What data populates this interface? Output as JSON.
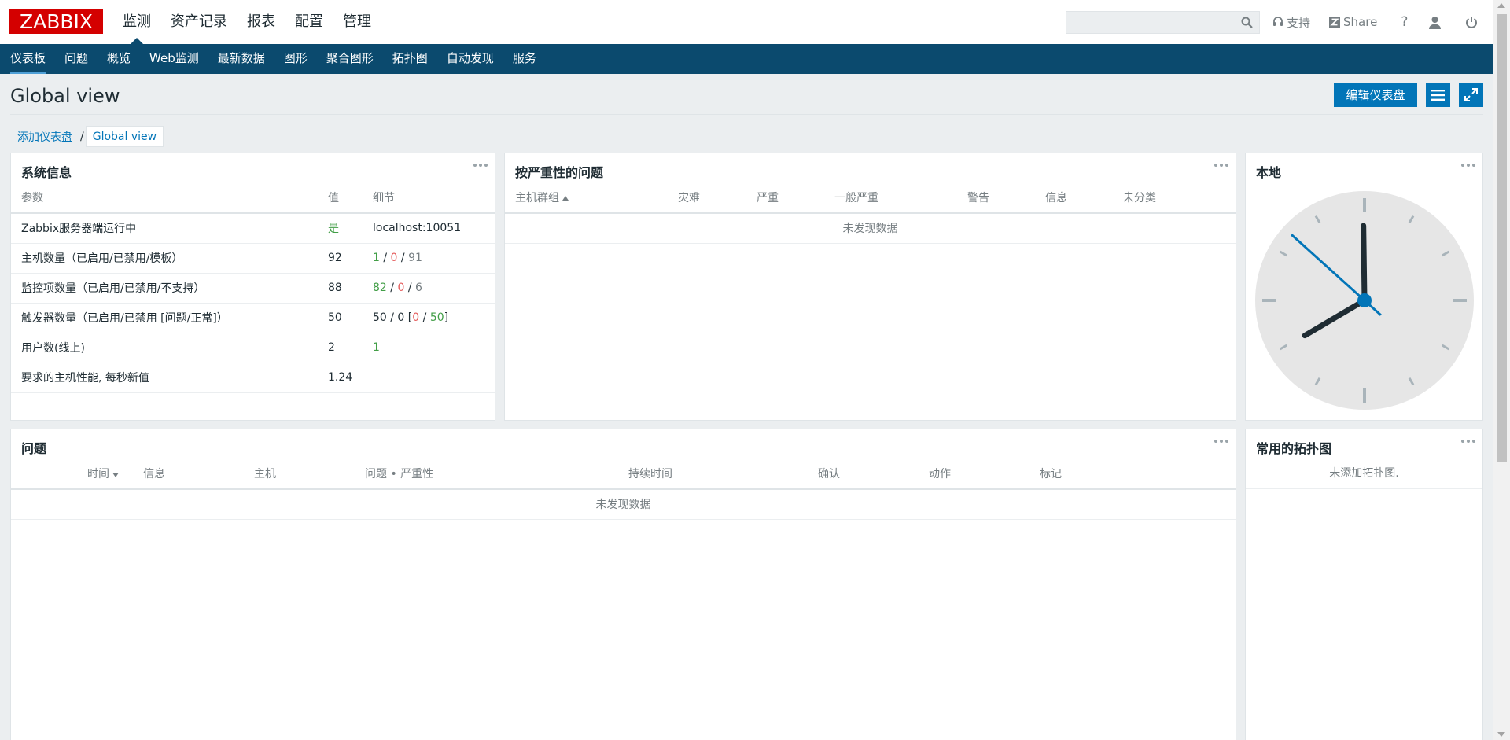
{
  "logo": {
    "text": "ZABBIX"
  },
  "topnav": {
    "items": [
      {
        "label": "监测",
        "active": true
      },
      {
        "label": "资产记录"
      },
      {
        "label": "报表"
      },
      {
        "label": "配置"
      },
      {
        "label": "管理"
      }
    ]
  },
  "search": {
    "value": "",
    "icon": "search-icon"
  },
  "tools": {
    "support": "支持",
    "share": "Share",
    "help": "?",
    "user_icon": "user-icon",
    "power_icon": "power-icon"
  },
  "subnav": {
    "items": [
      {
        "label": "仪表板",
        "active": true
      },
      {
        "label": "问题"
      },
      {
        "label": "概览"
      },
      {
        "label": "Web监测"
      },
      {
        "label": "最新数据"
      },
      {
        "label": "图形"
      },
      {
        "label": "聚合图形"
      },
      {
        "label": "拓扑图"
      },
      {
        "label": "自动发现"
      },
      {
        "label": "服务"
      }
    ]
  },
  "page": {
    "title": "Global view",
    "edit_button": "编辑仪表盘",
    "breadcrumb": {
      "link": "添加仪表盘",
      "separator": "/",
      "current": "Global view"
    }
  },
  "sysinfo": {
    "title": "系统信息",
    "columns": [
      "参数",
      "值",
      "细节"
    ],
    "rows": [
      {
        "param": "Zabbix服务器端运行中",
        "value": "是",
        "detail": [
          {
            "t": "localhost:10051",
            "c": ""
          }
        ]
      },
      {
        "param": "主机数量（已启用/已禁用/模板）",
        "value": "92",
        "detail": [
          {
            "t": "1",
            "c": "green"
          },
          {
            "t": " / ",
            "c": ""
          },
          {
            "t": "0",
            "c": "red"
          },
          {
            "t": " / ",
            "c": ""
          },
          {
            "t": "91",
            "c": "grey"
          }
        ]
      },
      {
        "param": "监控项数量（已启用/已禁用/不支持）",
        "value": "88",
        "detail": [
          {
            "t": "82",
            "c": "green"
          },
          {
            "t": " / ",
            "c": ""
          },
          {
            "t": "0",
            "c": "red"
          },
          {
            "t": " / ",
            "c": ""
          },
          {
            "t": "6",
            "c": "grey"
          }
        ]
      },
      {
        "param": "触发器数量（已启用/已禁用 [问题/正常]）",
        "value": "50",
        "detail": [
          {
            "t": "50 / 0 [",
            "c": ""
          },
          {
            "t": "0",
            "c": "red"
          },
          {
            "t": " / ",
            "c": ""
          },
          {
            "t": "50",
            "c": "green"
          },
          {
            "t": "]",
            "c": ""
          }
        ]
      },
      {
        "param": "用户数(线上)",
        "value": "2",
        "detail": [
          {
            "t": "1",
            "c": "green"
          }
        ]
      },
      {
        "param": "要求的主机性能, 每秒新值",
        "value": "1.24",
        "detail": []
      }
    ]
  },
  "severity": {
    "title": "按严重性的问题",
    "columns": [
      "主机群组",
      "灾难",
      "严重",
      "一般严重",
      "警告",
      "信息",
      "未分类"
    ],
    "empty": "未发现数据"
  },
  "clock": {
    "title": "本地",
    "hour": 7,
    "minute": 59,
    "second": 52
  },
  "problems": {
    "title": "问题",
    "columns": [
      "时间",
      "信息",
      "主机",
      "问题 • 严重性",
      "持续时间",
      "确认",
      "动作",
      "标记"
    ],
    "empty": "未发现数据"
  },
  "maps": {
    "title": "常用的拓扑图",
    "empty": "未添加拓扑图."
  },
  "colors": {
    "brand_red": "#d40000",
    "nav_blue": "#0b4a6e",
    "button_blue": "#0275b8"
  }
}
